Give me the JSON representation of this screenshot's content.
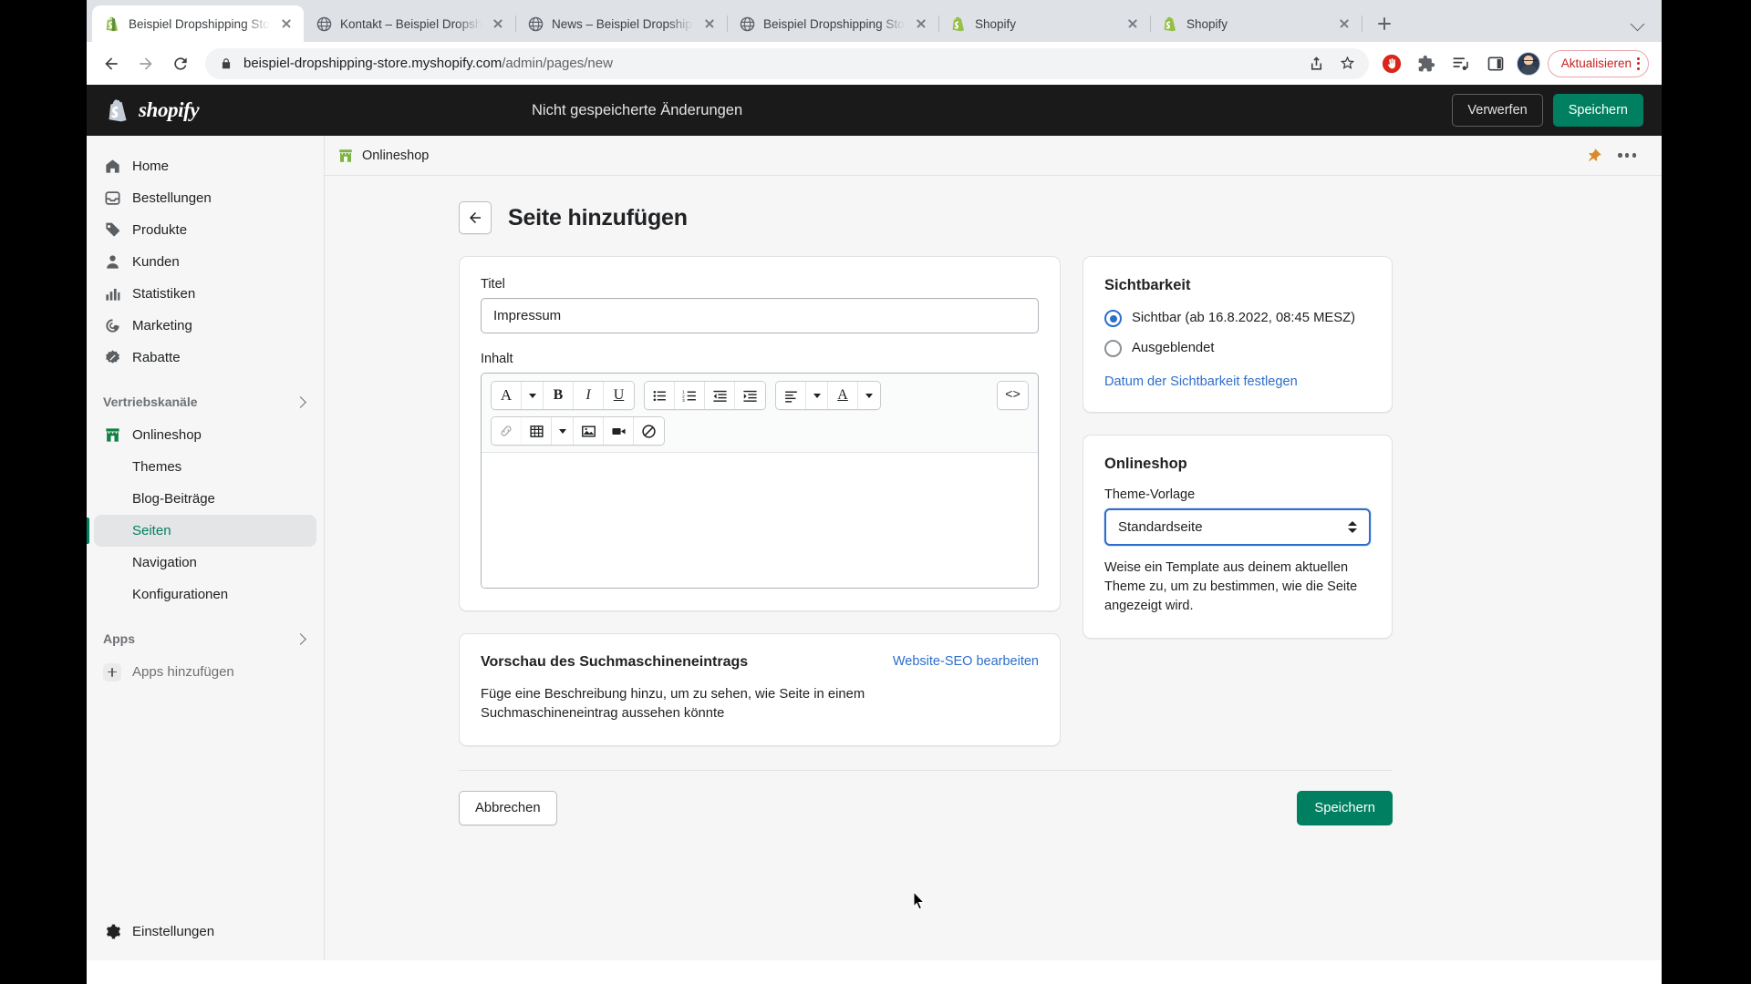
{
  "browser": {
    "tabs": [
      {
        "title": "Beispiel Dropshipping Store",
        "favicon": "shopify-icon",
        "active": true
      },
      {
        "title": "Kontakt – Beispiel Dropshipping Store",
        "favicon": "globe-icon",
        "active": false
      },
      {
        "title": "News – Beispiel Dropshipping Store",
        "favicon": "globe-icon",
        "active": false
      },
      {
        "title": "Beispiel Dropshipping Store",
        "favicon": "globe-icon",
        "active": false
      },
      {
        "title": "Shopify",
        "favicon": "shopify-icon",
        "active": false
      },
      {
        "title": "Shopify",
        "favicon": "shopify-icon",
        "active": false
      }
    ],
    "new_tab_label": "+",
    "url_domain": "beispiel-dropshipping-store.myshopify.com",
    "url_path": "/admin/pages/new",
    "update_button": "Aktualisieren",
    "icons": {
      "back": "back-arrow-icon",
      "forward": "forward-arrow-icon",
      "reload": "reload-icon",
      "lock": "lock-icon",
      "share": "share-icon",
      "bookmark": "star-icon",
      "adblock": "adblock-icon",
      "extensions": "puzzle-icon",
      "readinglist": "media-list-icon",
      "sidepanel": "side-panel-icon",
      "profile": "avatar-icon"
    }
  },
  "admin": {
    "brand": "shopify",
    "unsaved_message": "Nicht gespeicherte Änderungen",
    "discard_label": "Verwerfen",
    "save_label": "Speichern",
    "accent_green": "#008060",
    "active_green": "#007f5f",
    "link_blue": "#2c6ecb"
  },
  "sidebar": {
    "primary": [
      {
        "label": "Home",
        "icon": "home-icon"
      },
      {
        "label": "Bestellungen",
        "icon": "orders-inbox-icon"
      },
      {
        "label": "Produkte",
        "icon": "tag-icon"
      },
      {
        "label": "Kunden",
        "icon": "person-icon"
      },
      {
        "label": "Statistiken",
        "icon": "bar-chart-icon"
      },
      {
        "label": "Marketing",
        "icon": "megaphone-target-icon"
      },
      {
        "label": "Rabatte",
        "icon": "discount-badge-icon"
      }
    ],
    "channels_group": "Vertriebskanäle",
    "channels": [
      {
        "label": "Onlineshop",
        "icon": "storefront-icon",
        "active": false
      },
      {
        "label": "Themes",
        "active": false
      },
      {
        "label": "Blog-Beiträge",
        "active": false
      },
      {
        "label": "Seiten",
        "active": true
      },
      {
        "label": "Navigation",
        "active": false
      },
      {
        "label": "Konfigurationen",
        "active": false
      }
    ],
    "apps_group": "Apps",
    "add_apps": "Apps hinzufügen",
    "settings": "Einstellungen"
  },
  "context_bar": {
    "shop_name": "Onlineshop",
    "pin_icon": "pin-icon",
    "more_icon": "more-dots-icon"
  },
  "page": {
    "back_icon": "back-arrow-icon",
    "title": "Seite hinzufügen",
    "title_field": {
      "label": "Titel",
      "value": "Impressum",
      "placeholder": ""
    },
    "content_field": {
      "label": "Inhalt",
      "value": ""
    },
    "editor_toolbar": {
      "row1": [
        {
          "name": "format-style-button",
          "glyph": "A",
          "has_caret": true
        },
        {
          "name": "bold-button",
          "glyph": "B"
        },
        {
          "name": "italic-button",
          "glyph": "I"
        },
        {
          "name": "underline-button",
          "glyph": "U"
        },
        {
          "name": "bulleted-list-button",
          "glyph": "bullet-list-icon"
        },
        {
          "name": "numbered-list-button",
          "glyph": "numbered-list-icon"
        },
        {
          "name": "outdent-button",
          "glyph": "outdent-icon"
        },
        {
          "name": "indent-button",
          "glyph": "indent-icon"
        },
        {
          "name": "align-button",
          "glyph": "align-left-icon",
          "has_caret": true
        },
        {
          "name": "text-color-button",
          "glyph": "A",
          "has_caret": true
        }
      ],
      "row2": [
        {
          "name": "insert-link-button",
          "glyph": "link-icon",
          "disabled": true
        },
        {
          "name": "insert-table-button",
          "glyph": "table-icon",
          "has_caret": true
        },
        {
          "name": "insert-image-button",
          "glyph": "image-icon"
        },
        {
          "name": "insert-video-button",
          "glyph": "video-icon"
        },
        {
          "name": "clear-formatting-button",
          "glyph": "no-formatting-icon"
        }
      ],
      "code_button": {
        "name": "show-html-button",
        "glyph": "<>"
      }
    },
    "seo": {
      "title": "Vorschau des Suchmaschineneintrags",
      "edit_link": "Website-SEO bearbeiten",
      "body": "Füge eine Beschreibung hinzu, um zu sehen, wie Seite in einem Suchmaschineneintrag aussehen könnte"
    },
    "visibility": {
      "title": "Sichtbarkeit",
      "option_visible": "Sichtbar (ab 16.8.2022, 08:45 MESZ)",
      "option_hidden": "Ausgeblendet",
      "selected": "visible",
      "set_date_link": "Datum der Sichtbarkeit festlegen"
    },
    "online_store": {
      "title": "Onlineshop",
      "template_label": "Theme-Vorlage",
      "template_value": "Standardseite",
      "template_options": [
        "Standardseite"
      ],
      "help_text": "Weise ein Template aus deinem aktuellen Theme zu, um zu bestimmen, wie die Seite angezeigt wird."
    },
    "footer": {
      "cancel": "Abbrechen",
      "save": "Speichern"
    }
  }
}
